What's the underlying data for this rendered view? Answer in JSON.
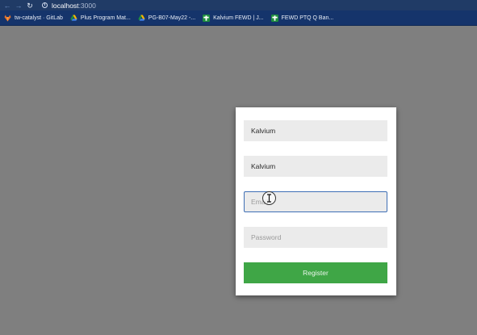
{
  "browser": {
    "url_host": "localhost",
    "url_port": ":3000",
    "bookmarks": [
      {
        "label": "tw-catalyst · GitLab",
        "icon": "gitlab-icon",
        "color": "#e2712d"
      },
      {
        "label": "Plus Program Mat...",
        "icon": "drive-icon",
        "color": "#f5b400"
      },
      {
        "label": "PG-B07-May22 -...",
        "icon": "drive-icon",
        "color": "#f5b400"
      },
      {
        "label": "Kalvium FEWD | J...",
        "icon": "plus-icon",
        "color": "#1e8e3e"
      },
      {
        "label": "FEWD PTQ Q Ban...",
        "icon": "plus-icon",
        "color": "#1e8e3e"
      }
    ]
  },
  "form": {
    "first_name_value": "Kalvium",
    "last_name_value": "Kalvium",
    "email_placeholder": "Email",
    "password_placeholder": "Password",
    "register_label": "Register"
  },
  "colors": {
    "register_button": "#3fa646",
    "focus_border": "#3f6fb5",
    "background": "#7f7f7f"
  }
}
